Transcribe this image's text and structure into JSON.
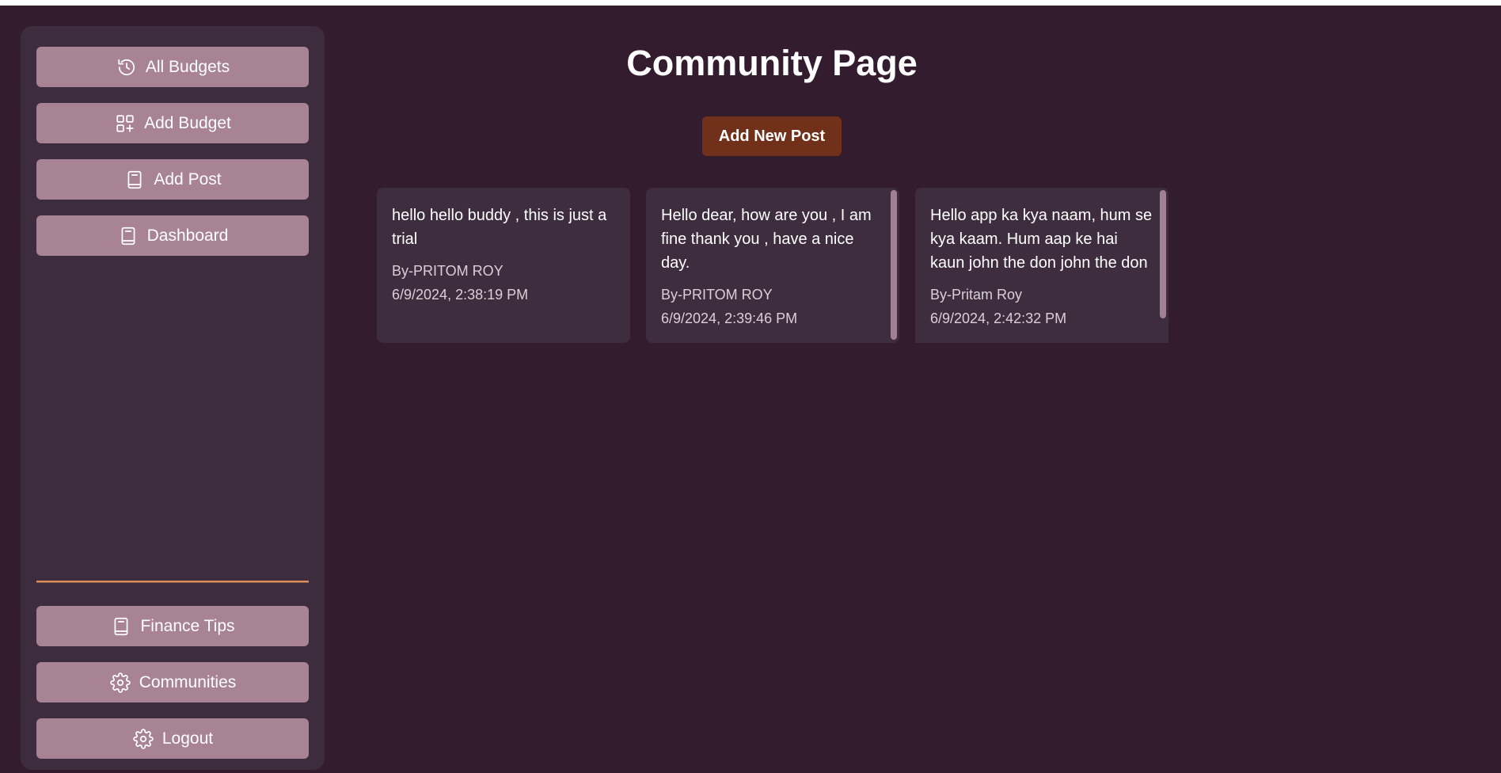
{
  "sidebar": {
    "top_items": [
      {
        "label": "All Budgets",
        "icon": "history-icon"
      },
      {
        "label": "Add Budget",
        "icon": "grid-plus-icon"
      },
      {
        "label": "Add Post",
        "icon": "book-icon"
      },
      {
        "label": "Dashboard",
        "icon": "book-icon"
      }
    ],
    "bottom_items": [
      {
        "label": "Finance Tips",
        "icon": "book-icon"
      },
      {
        "label": "Communities",
        "icon": "gear-icon"
      },
      {
        "label": "Logout",
        "icon": "gear-icon"
      }
    ]
  },
  "main": {
    "title": "Community Page",
    "add_post_label": "Add New Post"
  },
  "posts": [
    {
      "text": "hello hello buddy , this is just a trial",
      "author": "By-PRITOM ROY",
      "time": "6/9/2024, 2:38:19 PM"
    },
    {
      "text": "Hello dear, how are you , I am fine thank you , have a nice day.",
      "author": "By-PRITOM ROY",
      "time": "6/9/2024, 2:39:46 PM"
    },
    {
      "text": "Hello app ka kya naam, hum se kya kaam. Hum aap ke hai kaun john the don john the don",
      "author": "By-Pritam Roy",
      "time": "6/9/2024, 2:42:32 PM"
    }
  ],
  "colors": {
    "background": "#331c2e",
    "sidebar": "#3d2c3d",
    "nav_button": "#a78394",
    "accent_button": "#70301a",
    "card": "#3e2d3e"
  }
}
